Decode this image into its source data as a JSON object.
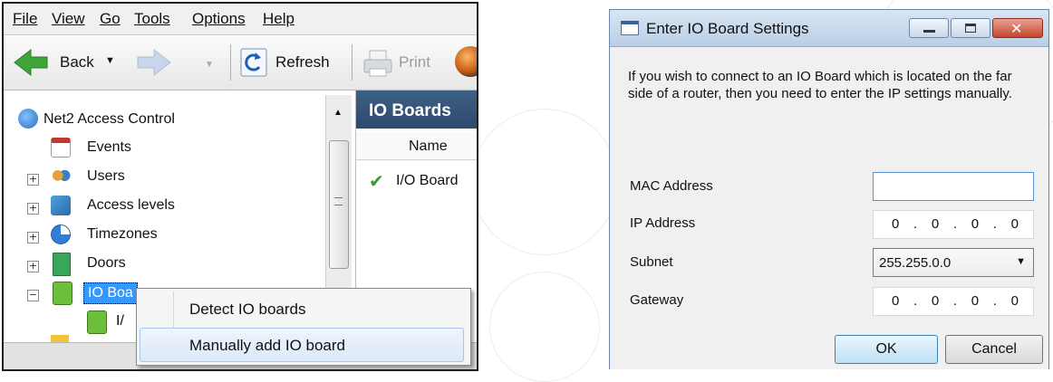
{
  "app_window": {
    "menu": [
      "File",
      "View",
      "Go",
      "Tools",
      "Options",
      "Help"
    ],
    "toolbar": {
      "back_label": "Back",
      "refresh_label": "Refresh",
      "print_label": "Print"
    },
    "tree": {
      "root": "Net2 Access Control",
      "items": [
        {
          "label": "Events",
          "expander": ""
        },
        {
          "label": "Users",
          "expander": "+"
        },
        {
          "label": "Access levels",
          "expander": "+"
        },
        {
          "label": "Timezones",
          "expander": "+"
        },
        {
          "label": "Doors",
          "expander": "+"
        },
        {
          "label": "IO Boa",
          "expander": "−"
        },
        {
          "label": "I/",
          "expander": ""
        }
      ]
    },
    "right_panel": {
      "header": "IO Boards",
      "column_name": "Name",
      "row": "I/O Board"
    },
    "context_menu": {
      "items": [
        "Detect IO boards",
        "Manually add IO board"
      ]
    }
  },
  "dialog": {
    "title": "Enter IO Board Settings",
    "description": "If you wish to connect to an IO Board which is located on the far side of a router, then you need to enter the IP settings manually.",
    "fields": {
      "mac_label": "MAC Address",
      "mac_value": "",
      "ip_label": "IP Address",
      "ip_octets": [
        "0",
        "0",
        "0",
        "0"
      ],
      "subnet_label": "Subnet",
      "subnet_value": "255.255.0.0",
      "gateway_label": "Gateway",
      "gateway_octets": [
        "0",
        "0",
        "0",
        "0"
      ]
    },
    "ok_label": "OK",
    "cancel_label": "Cancel"
  },
  "colors": {
    "header_blue": "#2f4f77",
    "selection_blue": "#3399ff",
    "dialog_title": "#c6d8ec"
  }
}
